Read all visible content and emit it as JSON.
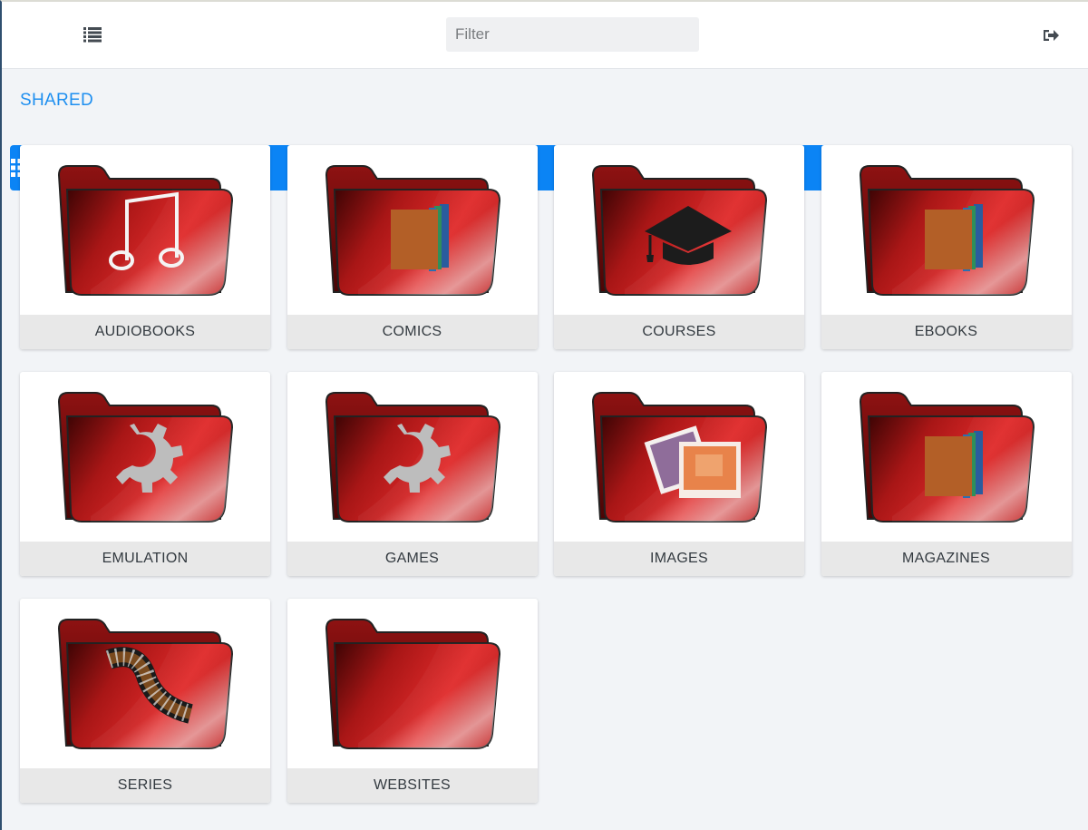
{
  "toolbar": {
    "grid_view_icon": "grid-view-icon",
    "list_view_icon": "list-view-icon",
    "filter_placeholder": "Filter",
    "filter_value": "",
    "logout_icon": "sign-out-icon",
    "accent_color": "#0b84f5"
  },
  "section": {
    "title": "SHARED",
    "title_color": "#1e8ff0"
  },
  "folders": [
    {
      "label": "AUDIOBOOKS",
      "emblem": "music-note-icon"
    },
    {
      "label": "COMICS",
      "emblem": "books-icon"
    },
    {
      "label": "COURSES",
      "emblem": "graduation-cap-icon"
    },
    {
      "label": "EBOOKS",
      "emblem": "books-icon"
    },
    {
      "label": "EMULATION",
      "emblem": "gear-icon"
    },
    {
      "label": "GAMES",
      "emblem": "gear-icon"
    },
    {
      "label": "IMAGES",
      "emblem": "photos-icon"
    },
    {
      "label": "MAGAZINES",
      "emblem": "books-icon"
    },
    {
      "label": "SERIES",
      "emblem": "film-strip-icon"
    },
    {
      "label": "WEBSITES",
      "emblem": "none"
    }
  ]
}
